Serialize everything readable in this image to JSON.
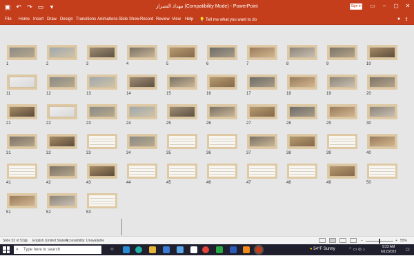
{
  "window": {
    "title": "مهداد الشيراز (Compatibility Mode)  -  PowerPoint",
    "signin": "Sign in",
    "qat_icons": [
      "save-icon",
      "undo-icon",
      "redo-icon",
      "present-icon",
      "customize-icon"
    ]
  },
  "ribbon": {
    "tabs": [
      "File",
      "Home",
      "Insert",
      "Draw",
      "Design",
      "Transitions",
      "Animations",
      "Slide Show",
      "Record",
      "Review",
      "View",
      "Help"
    ],
    "tell_me": "Tell me what you want to do"
  },
  "slides": [
    {
      "n": "1"
    },
    {
      "n": "2"
    },
    {
      "n": "3"
    },
    {
      "n": "4"
    },
    {
      "n": "5"
    },
    {
      "n": "6"
    },
    {
      "n": "7"
    },
    {
      "n": "8"
    },
    {
      "n": "9"
    },
    {
      "n": "10"
    },
    {
      "n": "11"
    },
    {
      "n": "12"
    },
    {
      "n": "13"
    },
    {
      "n": "14"
    },
    {
      "n": "15"
    },
    {
      "n": "16"
    },
    {
      "n": "17"
    },
    {
      "n": "18"
    },
    {
      "n": "19"
    },
    {
      "n": "20"
    },
    {
      "n": "21"
    },
    {
      "n": "22"
    },
    {
      "n": "23"
    },
    {
      "n": "24"
    },
    {
      "n": "25"
    },
    {
      "n": "26"
    },
    {
      "n": "27"
    },
    {
      "n": "28"
    },
    {
      "n": "29"
    },
    {
      "n": "30"
    },
    {
      "n": "31"
    },
    {
      "n": "32"
    },
    {
      "n": "33"
    },
    {
      "n": "34"
    },
    {
      "n": "35"
    },
    {
      "n": "36"
    },
    {
      "n": "37"
    },
    {
      "n": "38"
    },
    {
      "n": "39"
    },
    {
      "n": "40"
    },
    {
      "n": "41"
    },
    {
      "n": "42"
    },
    {
      "n": "43"
    },
    {
      "n": "44"
    },
    {
      "n": "45"
    },
    {
      "n": "46"
    },
    {
      "n": "47"
    },
    {
      "n": "48"
    },
    {
      "n": "49"
    },
    {
      "n": "50"
    },
    {
      "n": "51"
    },
    {
      "n": "52"
    },
    {
      "n": "53"
    }
  ],
  "status": {
    "slide_info": "Slide 53 of 53",
    "language": "English (United States)",
    "accessibility": "Accessibility: Unavailable",
    "zoom": "55%"
  },
  "taskbar": {
    "search_placeholder": "Type here to search",
    "weather": "54°F  Sunny",
    "time": "9:23 AM",
    "date": "6/12/2023"
  }
}
